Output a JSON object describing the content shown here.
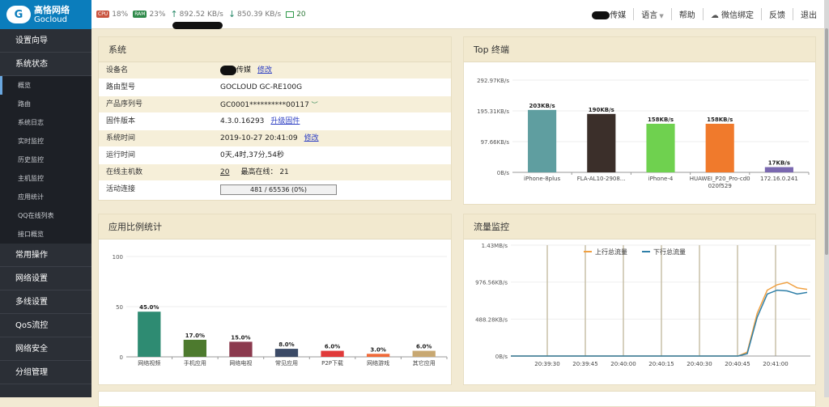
{
  "logo": {
    "line1": "高恪网络",
    "line2": "Gocloud"
  },
  "sidebar": {
    "menus": [
      {
        "label": "设置向导"
      },
      {
        "label": "系统状态"
      }
    ],
    "sub": [
      {
        "label": "概览"
      },
      {
        "label": "路由"
      },
      {
        "label": "系统日志"
      },
      {
        "label": "实时监控"
      },
      {
        "label": "历史监控"
      },
      {
        "label": "主机监控"
      },
      {
        "label": "应用统计"
      },
      {
        "label": "QQ在线列表"
      },
      {
        "label": "接口概览"
      }
    ],
    "menus2": [
      {
        "label": "常用操作"
      },
      {
        "label": "网络设置"
      },
      {
        "label": "多线设置"
      },
      {
        "label": "QoS流控"
      },
      {
        "label": "网络安全"
      },
      {
        "label": "分组管理"
      }
    ]
  },
  "topbar": {
    "cpu_badge": "CPU",
    "cpu": "18%",
    "ram_badge": "RAM",
    "ram": "23%",
    "up_icon": "arrow-up-icon",
    "up": "892.52 KB/s",
    "down_icon": "arrow-down-icon",
    "down": "850.39 KB/s",
    "online_icon": "monitor-icon",
    "online": "20",
    "user_suffix": "传媒",
    "lang": "语言",
    "help": "帮助",
    "wechat": "微信绑定",
    "feedback": "反馈",
    "logout": "退出"
  },
  "system": {
    "title": "系统",
    "rows": [
      {
        "k": "设备名",
        "v": "传媒",
        "link": "修改"
      },
      {
        "k": "路由型号",
        "v": "GOCLOUD GC-RE100G"
      },
      {
        "k": "产品序列号",
        "v": "GC0001**********00117"
      },
      {
        "k": "固件版本",
        "v": "4.3.0.16293",
        "link": "升级固件"
      },
      {
        "k": "系统时间",
        "v": "2019-10-27 20:41:09",
        "link": "修改"
      },
      {
        "k": "运行时间",
        "v": "0天,4时,37分,54秒"
      },
      {
        "k": "在线主机数",
        "v": "20",
        "extra": "最高在线： 21"
      },
      {
        "k": "活动连接",
        "progress": "481 / 65536 (0%)"
      }
    ]
  },
  "top": {
    "title": "Top 终端"
  },
  "app": {
    "title": "应用比例统计"
  },
  "flow": {
    "title": "流量监控"
  },
  "chart_data": [
    {
      "type": "bar",
      "title": "Top 终端",
      "categories": [
        "iPhone-8plus",
        "FLA-AL10-2908…",
        "iPhone-4",
        "HUAWEI_P20_Pro-cd0020f529",
        "172.16.0.241"
      ],
      "values": [
        203,
        190,
        158,
        158,
        17
      ],
      "data_labels": [
        "203KB/s",
        "190KB/s",
        "158KB/s",
        "158KB/s",
        "17KB/s"
      ],
      "colors": [
        "#5f9ea0",
        "#3b2f2a",
        "#6fd14f",
        "#f07a2c",
        "#7a68b0"
      ],
      "yticks": [
        "0B/s",
        "97.66KB/s",
        "195.31KB/s",
        "292.97KB/s"
      ],
      "ylim": [
        0,
        300
      ]
    },
    {
      "type": "bar",
      "title": "应用比例统计",
      "categories": [
        "网络视频",
        "手机应用",
        "网络电视",
        "常见应用",
        "P2P下载",
        "网络游戏",
        "其它应用"
      ],
      "values": [
        45,
        17,
        15,
        8,
        6,
        3,
        6
      ],
      "data_labels": [
        "45.0%",
        "17.0%",
        "15.0%",
        "8.0%",
        "6.0%",
        "3.0%",
        "6.0%"
      ],
      "colors": [
        "#2e8b72",
        "#4d7a2e",
        "#8b3a4e",
        "#3b4a66",
        "#e03a3a",
        "#f06a3a",
        "#c8a872"
      ],
      "yticks": [
        "0",
        "50",
        "100"
      ],
      "ylim": [
        0,
        100
      ]
    },
    {
      "type": "line",
      "title": "流量监控",
      "xticks": [
        "20:39:30",
        "20:39:45",
        "20:40:00",
        "20:40:15",
        "20:40:30",
        "20:40:45",
        "20:41:00"
      ],
      "yticks": [
        "0B/s",
        "488.28KB/s",
        "976.56KB/s",
        "1.43MB/s"
      ],
      "ylim": [
        0,
        1.43
      ],
      "series": [
        {
          "name": "上行总流量",
          "color": "#f0a040",
          "values": [
            0,
            0,
            0,
            0,
            0,
            0,
            0,
            0,
            0,
            0,
            0,
            0,
            0,
            0,
            0,
            0,
            0,
            0,
            0,
            0,
            0,
            0,
            0,
            0,
            0,
            0,
            0.05,
            0.55,
            0.85,
            0.92,
            0.95,
            0.88,
            0.86
          ]
        },
        {
          "name": "下行总流量",
          "color": "#2f7fa8",
          "values": [
            0,
            0,
            0,
            0,
            0,
            0,
            0,
            0,
            0,
            0,
            0,
            0,
            0,
            0,
            0,
            0,
            0,
            0,
            0,
            0,
            0,
            0,
            0,
            0,
            0,
            0,
            0.03,
            0.5,
            0.8,
            0.85,
            0.84,
            0.8,
            0.82
          ]
        }
      ]
    }
  ]
}
